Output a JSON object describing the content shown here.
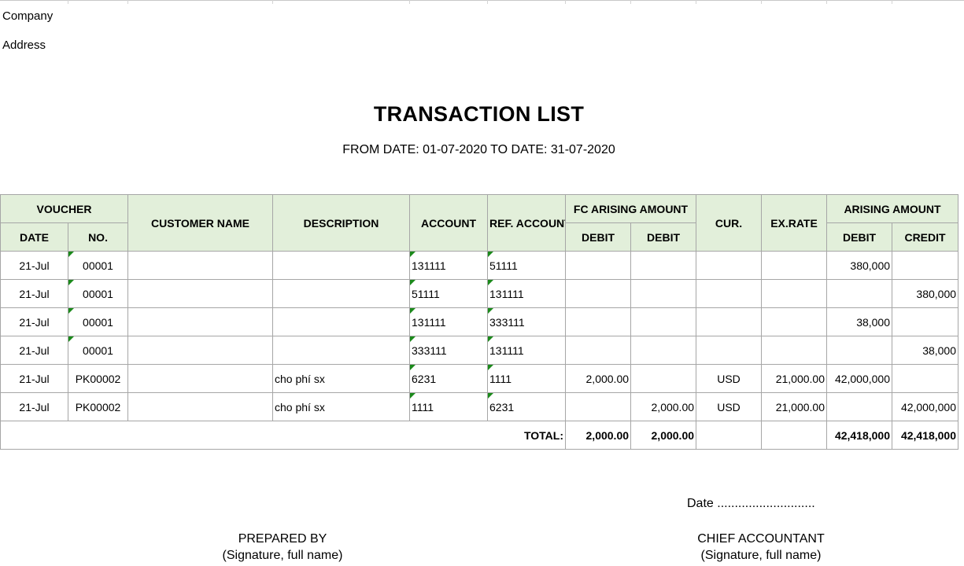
{
  "header": {
    "company_label": "Company",
    "address_label": "Address"
  },
  "report": {
    "title": "TRANSACTION LIST",
    "subtitle": "FROM DATE: 01-07-2020 TO DATE: 31-07-2020"
  },
  "table": {
    "headers": {
      "voucher": "VOUCHER",
      "date": "DATE",
      "no": "NO.",
      "customer_name": "CUSTOMER NAME",
      "description": "DESCRIPTION",
      "account": "ACCOUNT",
      "ref_account": "REF. ACCOUNT",
      "fc_arising_amount": "FC ARISING AMOUNT",
      "fc_debit_1": "DEBIT",
      "fc_debit_2": "DEBIT",
      "cur": "CUR.",
      "ex_rate": "EX.RATE",
      "arising_amount": "ARISING AMOUNT",
      "debit": "DEBIT",
      "credit": "CREDIT"
    },
    "rows": [
      {
        "date": "21-Jul",
        "no": "00001",
        "customer": "",
        "description": "",
        "account": "131111",
        "ref_account": "51111",
        "fc_debit": "",
        "fc_credit": "",
        "cur": "",
        "ex_rate": "",
        "debit": "380,000",
        "credit": ""
      },
      {
        "date": "21-Jul",
        "no": "00001",
        "customer": "",
        "description": "",
        "account": "51111",
        "ref_account": "131111",
        "fc_debit": "",
        "fc_credit": "",
        "cur": "",
        "ex_rate": "",
        "debit": "",
        "credit": "380,000"
      },
      {
        "date": "21-Jul",
        "no": "00001",
        "customer": "",
        "description": "",
        "account": "131111",
        "ref_account": "333111",
        "fc_debit": "",
        "fc_credit": "",
        "cur": "",
        "ex_rate": "",
        "debit": "38,000",
        "credit": ""
      },
      {
        "date": "21-Jul",
        "no": "00001",
        "customer": "",
        "description": "",
        "account": "333111",
        "ref_account": "131111",
        "fc_debit": "",
        "fc_credit": "",
        "cur": "",
        "ex_rate": "",
        "debit": "",
        "credit": "38,000"
      },
      {
        "date": "21-Jul",
        "no": "PK00002",
        "customer": "",
        "description": "cho phí sx",
        "account": "6231",
        "ref_account": "1111",
        "fc_debit": "2,000.00",
        "fc_credit": "",
        "cur": "USD",
        "ex_rate": "21,000.00",
        "debit": "42,000,000",
        "credit": ""
      },
      {
        "date": "21-Jul",
        "no": "PK00002",
        "customer": "",
        "description": "cho phí sx",
        "account": "1111",
        "ref_account": "6231",
        "fc_debit": "",
        "fc_credit": "2,000.00",
        "cur": "USD",
        "ex_rate": "21,000.00",
        "debit": "",
        "credit": "42,000,000"
      }
    ],
    "total": {
      "label": "TOTAL:",
      "fc_debit": "2,000.00",
      "fc_credit": "2,000.00",
      "debit": "42,418,000",
      "credit": "42,418,000"
    }
  },
  "footer": {
    "date_line": "Date ............................",
    "prepared_by": "PREPARED BY",
    "prepared_by_sub": "(Signature, full name)",
    "chief_accountant": "CHIEF ACCOUNTANT",
    "chief_accountant_sub": "(Signature, full name)"
  },
  "colors": {
    "header_fill": "#e2efda",
    "border": "#a6a6a6",
    "cell_flag": "#1b8a1b"
  }
}
